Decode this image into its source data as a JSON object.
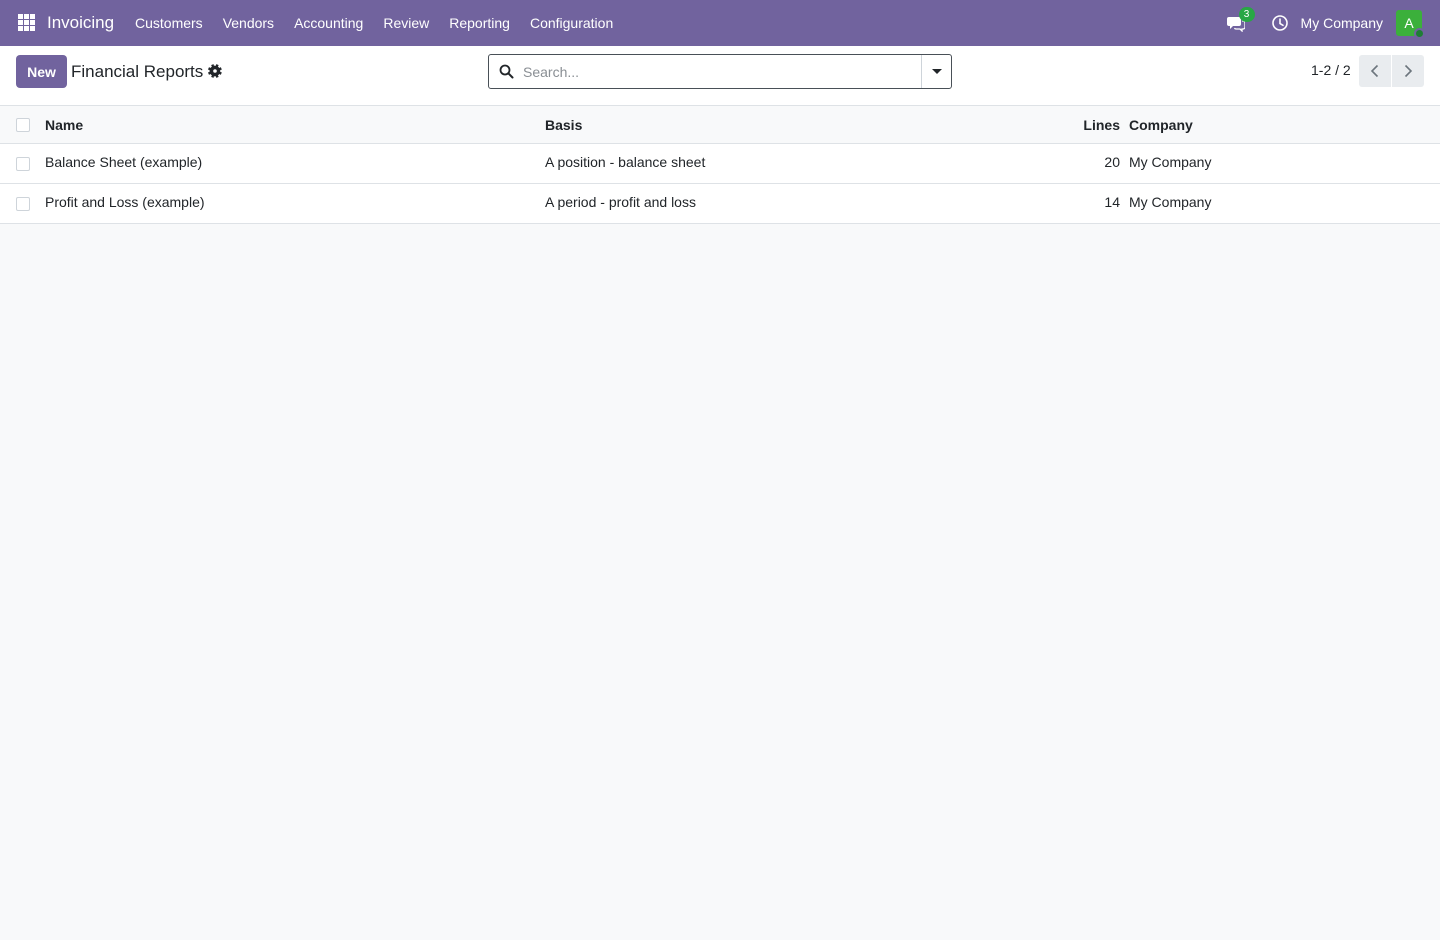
{
  "navbar": {
    "app_name": "Invoicing",
    "menu": [
      "Customers",
      "Vendors",
      "Accounting",
      "Review",
      "Reporting",
      "Configuration"
    ],
    "chat_count": "3",
    "company": "My Company",
    "avatar_letter": "A",
    "accent_color": "#71639e",
    "avatar_color": "#3bb03b"
  },
  "control_panel": {
    "new_label": "New",
    "title": "Financial Reports",
    "search_placeholder": "Search...",
    "pager": "1-2 / 2"
  },
  "list": {
    "columns": [
      "Name",
      "Basis",
      "Lines",
      "Company"
    ],
    "rows": [
      {
        "name": "Balance Sheet (example)",
        "basis": "A position - balance sheet",
        "lines": "20",
        "company": "My Company"
      },
      {
        "name": "Profit and Loss (example)",
        "basis": "A period - profit and loss",
        "lines": "14",
        "company": "My Company"
      }
    ]
  }
}
